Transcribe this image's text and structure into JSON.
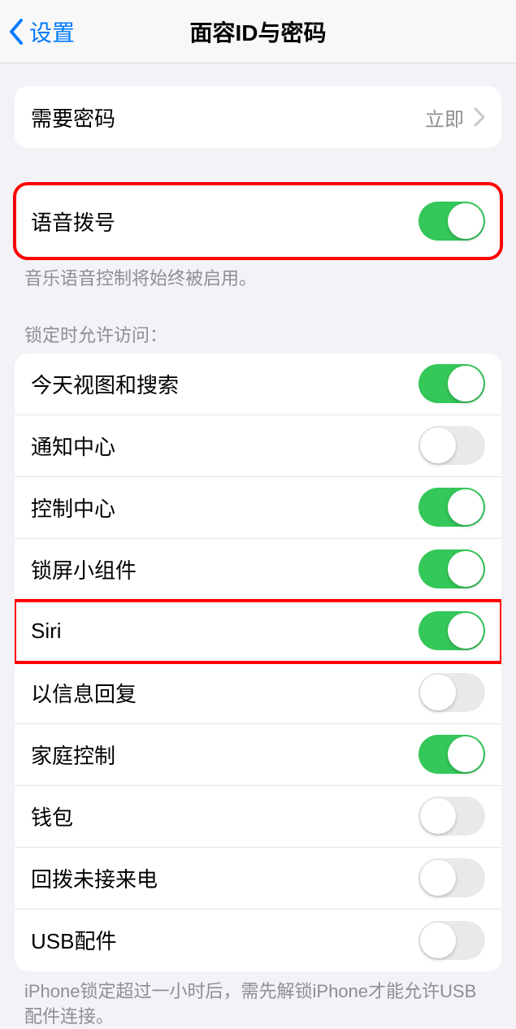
{
  "header": {
    "back_label": "设置",
    "title": "面容ID与密码"
  },
  "require_passcode": {
    "label": "需要密码",
    "value": "立即"
  },
  "voice_dial": {
    "label": "语音拨号",
    "enabled": true,
    "footer": "音乐语音控制将始终被启用。"
  },
  "lock_access": {
    "header": "锁定时允许访问：",
    "items": [
      {
        "label": "今天视图和搜索",
        "enabled": true
      },
      {
        "label": "通知中心",
        "enabled": false
      },
      {
        "label": "控制中心",
        "enabled": true
      },
      {
        "label": "锁屏小组件",
        "enabled": true
      },
      {
        "label": "Siri",
        "enabled": true
      },
      {
        "label": "以信息回复",
        "enabled": false
      },
      {
        "label": "家庭控制",
        "enabled": true
      },
      {
        "label": "钱包",
        "enabled": false
      },
      {
        "label": "回拨未接来电",
        "enabled": false
      },
      {
        "label": "USB配件",
        "enabled": false
      }
    ],
    "footer": "iPhone锁定超过一小时后，需先解锁iPhone才能允许USB配件连接。"
  }
}
